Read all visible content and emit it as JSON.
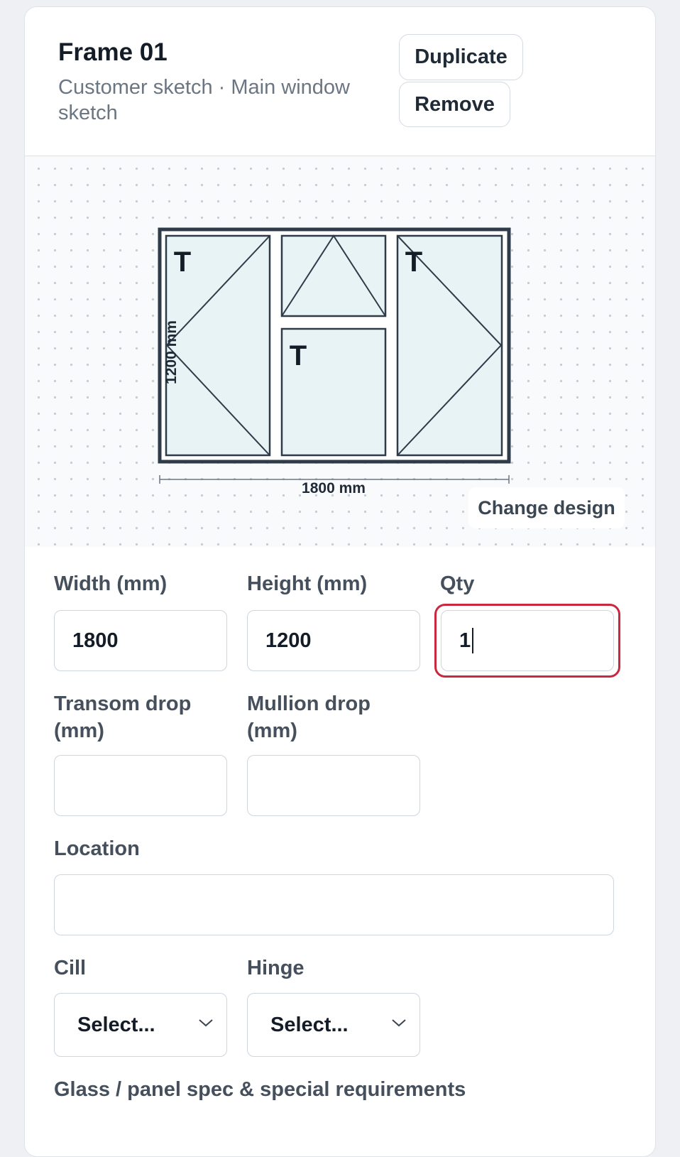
{
  "frame": {
    "title": "Frame 01",
    "subtitle": "Customer sketch · Main window sketch",
    "duplicate_label": "Duplicate",
    "remove_label": "Remove"
  },
  "sketch": {
    "height_label": "1200 mm",
    "width_label": "1800 mm",
    "sash_marker": "T",
    "change_design_label": "Change design"
  },
  "form": {
    "width_label": "Width (mm)",
    "width_value": "1800",
    "height_label": "Height (mm)",
    "height_value": "1200",
    "qty_label": "Qty",
    "qty_value": "1",
    "transom_label": "Transom drop (mm)",
    "transom_value": "",
    "mullion_label": "Mullion drop (mm)",
    "mullion_value": "",
    "location_label": "Location",
    "location_value": "",
    "cill_label": "Cill",
    "cill_value": "Select...",
    "hinge_label": "Hinge",
    "hinge_value": "Select...",
    "glass_label": "Glass / panel spec & special requirements"
  },
  "colors": {
    "frame_stroke": "#2f3b48",
    "glass_fill": "#e8f3f6",
    "focus_ring": "#c9283e"
  }
}
